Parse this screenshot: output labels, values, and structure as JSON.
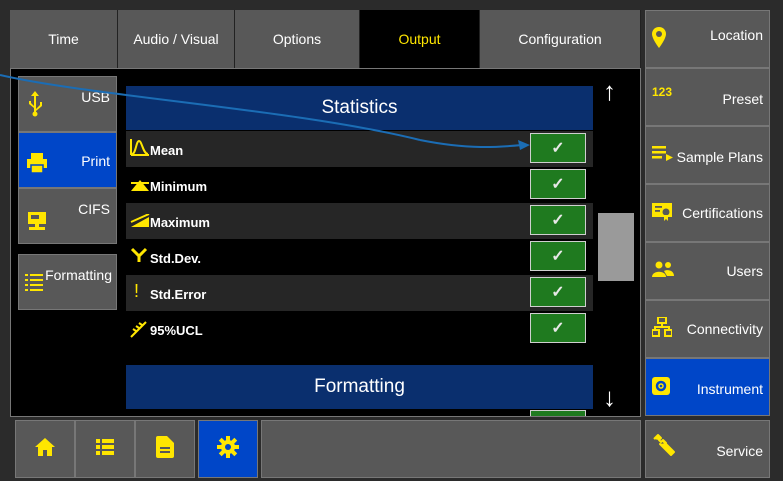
{
  "tabs": [
    {
      "label": "Time",
      "active": false
    },
    {
      "label": "Audio / Visual",
      "active": false
    },
    {
      "label": "Options",
      "active": false
    },
    {
      "label": "Output",
      "active": true
    },
    {
      "label": "Configuration",
      "active": false
    }
  ],
  "subnav": {
    "usb": "USB",
    "print": "Print",
    "cifs": "CIFS",
    "formatting": "Formatting"
  },
  "statistics": {
    "title": "Statistics",
    "rows": [
      {
        "label": "Mean",
        "checked": true
      },
      {
        "label": "Minimum",
        "checked": true
      },
      {
        "label": "Maximum",
        "checked": true
      },
      {
        "label": "Std.Dev.",
        "checked": true
      },
      {
        "label": "Std.Error",
        "checked": true
      },
      {
        "label": "95%UCL",
        "checked": true
      }
    ],
    "check_glyph": "✓"
  },
  "formatting_section": {
    "title": "Formatting"
  },
  "scroll": {
    "up": "↑",
    "down": "↓"
  },
  "sidebar": {
    "location": "Location",
    "preset": "Preset",
    "preset_icon_text": "123",
    "sample_plans": "Sample Plans",
    "certifications": "Certifications",
    "users": "Users",
    "connectivity": "Connectivity",
    "instrument": "Instrument",
    "service": "Service"
  },
  "colors": {
    "accent_yellow": "#ffe600",
    "active_blue": "#0046c8",
    "header_navy": "#0a2f6e",
    "check_green": "#1f7a1f",
    "callout_line": "#1b6db5"
  }
}
